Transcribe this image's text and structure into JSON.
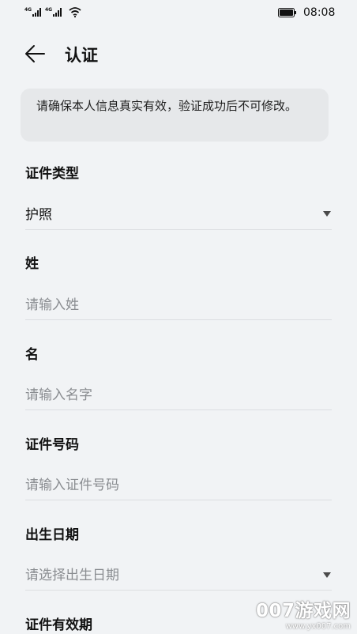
{
  "status_bar": {
    "signal1": "4G",
    "signal2": "4G",
    "time": "08:08"
  },
  "header": {
    "title": "认证"
  },
  "notice": "请确保本人信息真实有效，验证成功后不可修改。",
  "form": {
    "id_type": {
      "label": "证件类型",
      "value": "护照"
    },
    "surname": {
      "label": "姓",
      "placeholder": "请输入姓"
    },
    "given_name": {
      "label": "名",
      "placeholder": "请输入名字"
    },
    "id_number": {
      "label": "证件号码",
      "placeholder": "请输入证件号码"
    },
    "birth_date": {
      "label": "出生日期",
      "placeholder": "请选择出生日期"
    },
    "validity": {
      "label": "证件有效期"
    }
  },
  "watermark": {
    "brand": "007游戏网",
    "url": "www.yx007.com"
  }
}
